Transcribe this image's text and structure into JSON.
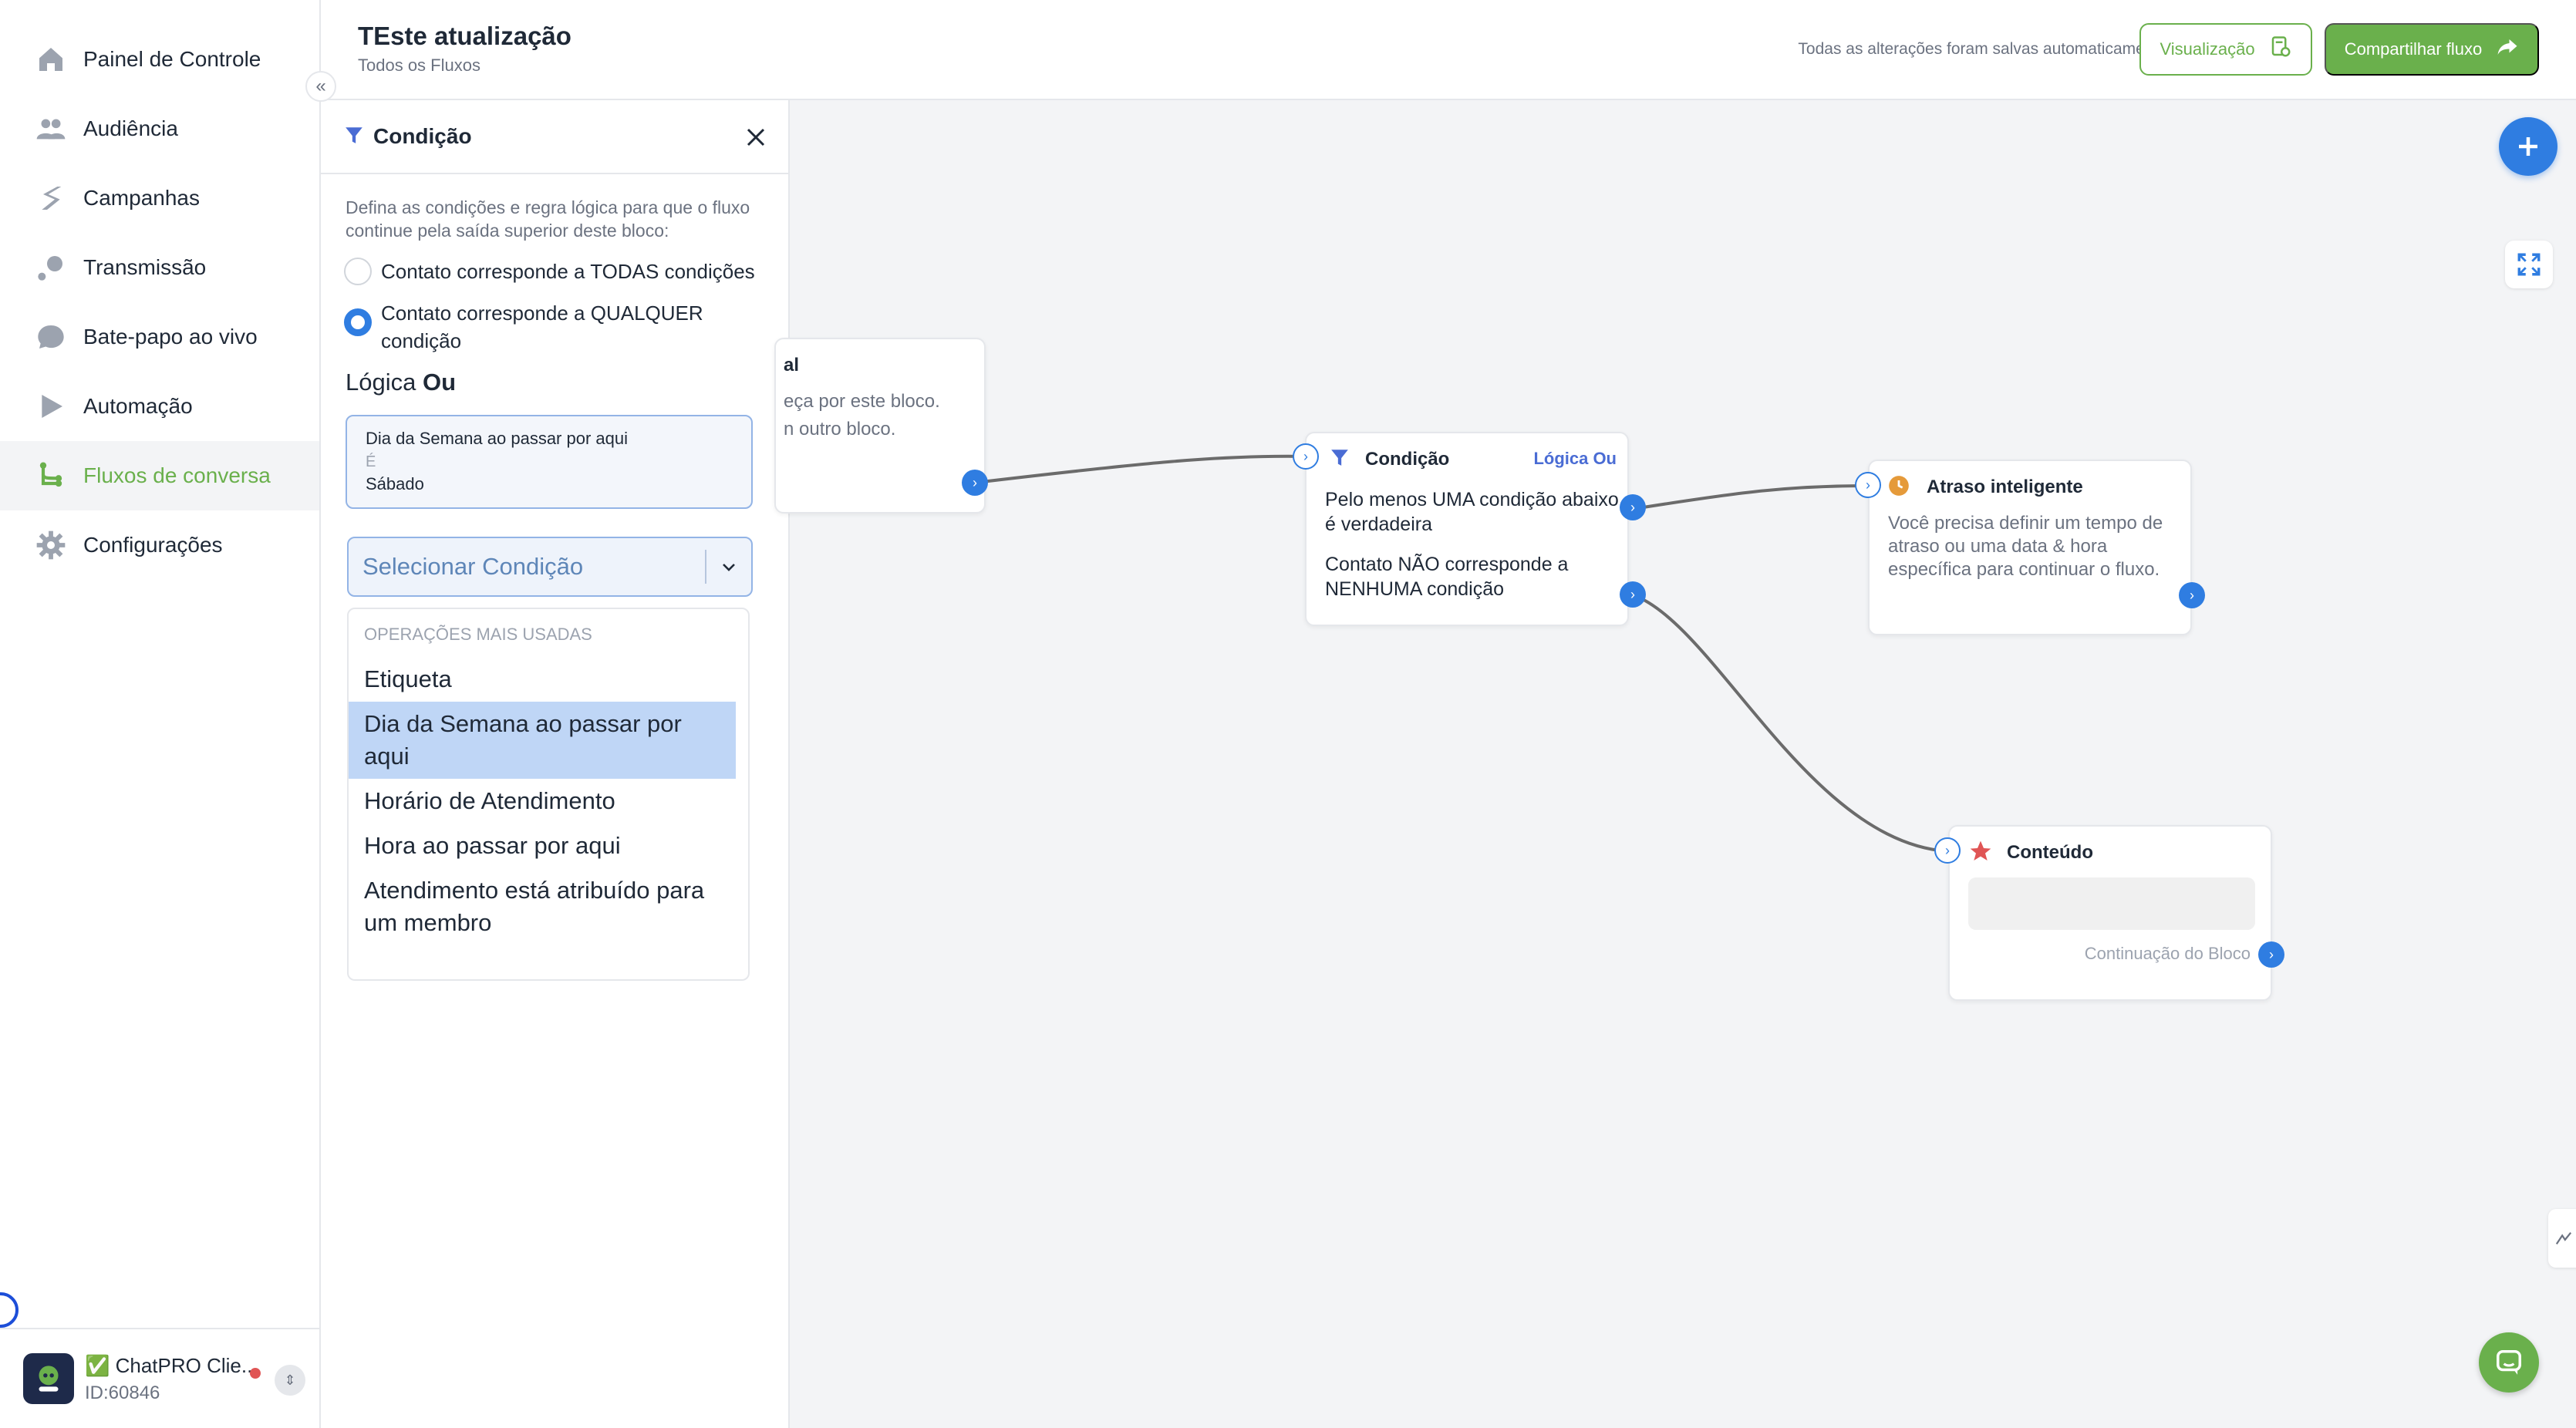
{
  "sidebar": {
    "items": [
      {
        "label": "Painel de Controle",
        "icon": "home-icon"
      },
      {
        "label": "Audiência",
        "icon": "users-icon"
      },
      {
        "label": "Campanhas",
        "icon": "campaign-icon"
      },
      {
        "label": "Transmissão",
        "icon": "broadcast-icon"
      },
      {
        "label": "Bate-papo ao vivo",
        "icon": "chat-icon"
      },
      {
        "label": "Automação",
        "icon": "automation-icon"
      },
      {
        "label": "Fluxos de conversa",
        "icon": "flow-icon"
      },
      {
        "label": "Configurações",
        "icon": "gear-icon"
      }
    ],
    "active_index": 6,
    "account": {
      "name": "✅ ChatPRO Clie...",
      "id": "ID:60846",
      "status_color": "#e05555"
    }
  },
  "header": {
    "title": "TEste atualização",
    "breadcrumb": "Todos os Fluxos",
    "autosave": "Todas as alterações foram salvas automaticamente",
    "preview_label": "Visualização",
    "share_label": "Compartilhar fluxo"
  },
  "panel": {
    "title": "Condição",
    "description": "Defina as condições e regra lógica para que o fluxo continue pela saída superior deste bloco:",
    "radio_all": "Contato corresponde a TODAS condições",
    "radio_any": "Contato corresponde a QUALQUER condição",
    "logic_label": "Lógica",
    "logic_value": "Ou",
    "condition": {
      "field": "Dia da Semana ao passar por aqui",
      "operator": "É",
      "value": "Sábado"
    },
    "select_placeholder": "Selecionar Condição",
    "dropdown": {
      "group": "OPERAÇÕES MAIS USADAS",
      "items": [
        "Etiqueta",
        "Dia da Semana ao passar por aqui",
        "Horário de Atendimento",
        "Hora ao passar por aqui",
        "Atendimento está atribuído para um membro"
      ],
      "highlighted_index": 1
    }
  },
  "canvas": {
    "start_node": {
      "title": "al",
      "text_line1": "eça por este bloco.",
      "text_line2": "n outro bloco."
    },
    "condition_node": {
      "title": "Condição",
      "badge": "Lógica Ou",
      "true_text": "Pelo menos UMA condição abaixo é verdadeira",
      "false_text": "Contato NÃO corresponde a NENHUMA condição"
    },
    "delay_node": {
      "title": "Atraso inteligente",
      "text": "Você precisa definir um tempo de atraso ou uma data & hora específica para continuar o fluxo."
    },
    "content_node": {
      "title": "Conteúdo",
      "continuation": "Continuação do Bloco"
    }
  },
  "colors": {
    "accent_green": "#6ab04c",
    "accent_blue": "#2f7de1"
  }
}
